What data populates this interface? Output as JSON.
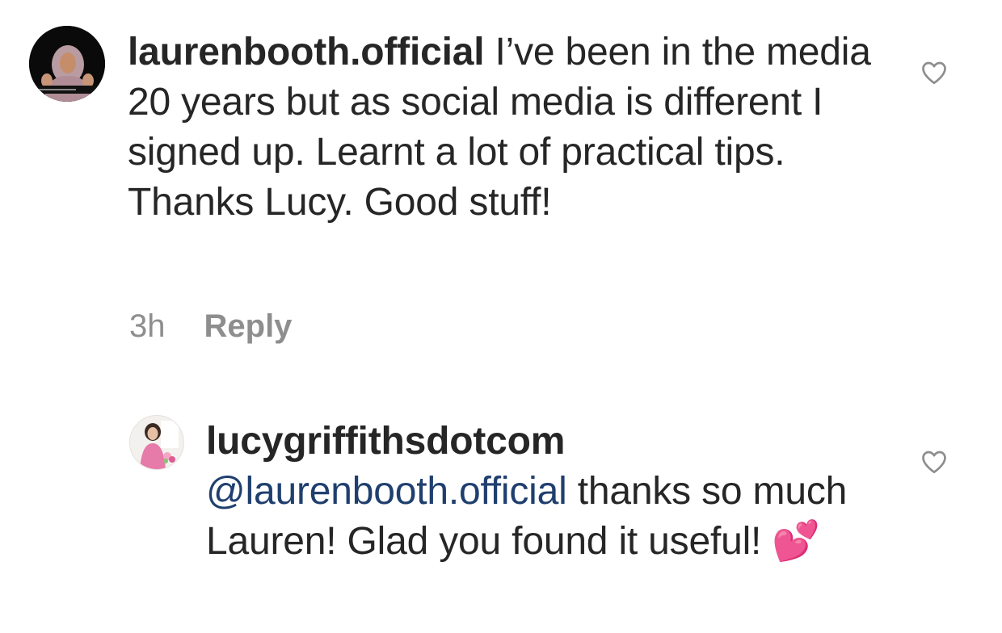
{
  "comments": [
    {
      "username": "laurenbooth.official",
      "text": "I’ve been in the media 20 years but as social media is different I signed up. Learnt a lot of practical tips. Thanks Lucy. Good stuff!",
      "time": "3h",
      "reply_label": "Reply",
      "avatar_icon": "profile-photo-woman-hijab",
      "like_icon": "heart-outline-icon"
    },
    {
      "username": "lucygriffithsdotcom",
      "mention": "@laurenbooth.official",
      "text": "thanks so much Lauren! Glad you found it useful!",
      "emoji": "💕",
      "avatar_icon": "profile-photo-woman-pink-dress",
      "like_icon": "heart-outline-icon"
    }
  ],
  "colors": {
    "text": "#262626",
    "meta": "#8e8e8e",
    "mention": "#1f3f6e",
    "emoji_pink": "#f04f93"
  }
}
